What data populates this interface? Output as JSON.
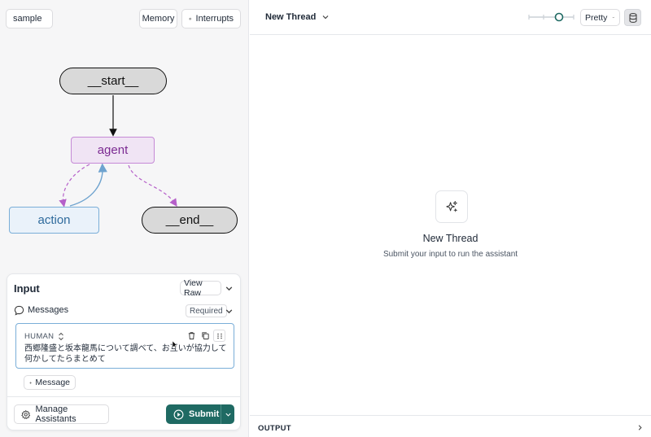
{
  "graph_selector": {
    "value": "sample"
  },
  "top_left_buttons": {
    "memory": "Memory",
    "interrupts": "Interrupts"
  },
  "graph": {
    "nodes": {
      "start": "__start__",
      "agent": "agent",
      "action": "action",
      "end": "__end__"
    },
    "colors": {
      "agent": "#7b2a92",
      "action": "#2e6a9c",
      "edge_dashed": "#b55fc9",
      "edge_solid": "#6ea3cf"
    }
  },
  "input_panel": {
    "title": "Input",
    "view_raw": "View Raw",
    "messages_label": "Messages",
    "required_badge": "Required",
    "message": {
      "role": "HUMAN",
      "text": "西郷隆盛と坂本龍馬について調べて、お互いが協力して何かしてたらまとめて"
    },
    "add_message": "Message",
    "manage_assistants": "Manage Assistants",
    "submit": "Submit"
  },
  "thread": {
    "title": "New Thread",
    "view_mode": "Pretty",
    "empty_title": "New Thread",
    "empty_subtitle": "Submit your input to run the assistant",
    "output_label": "OUTPUT"
  },
  "colors": {
    "accent": "#1f6a63",
    "panel_bg": "#f6f6f7"
  }
}
